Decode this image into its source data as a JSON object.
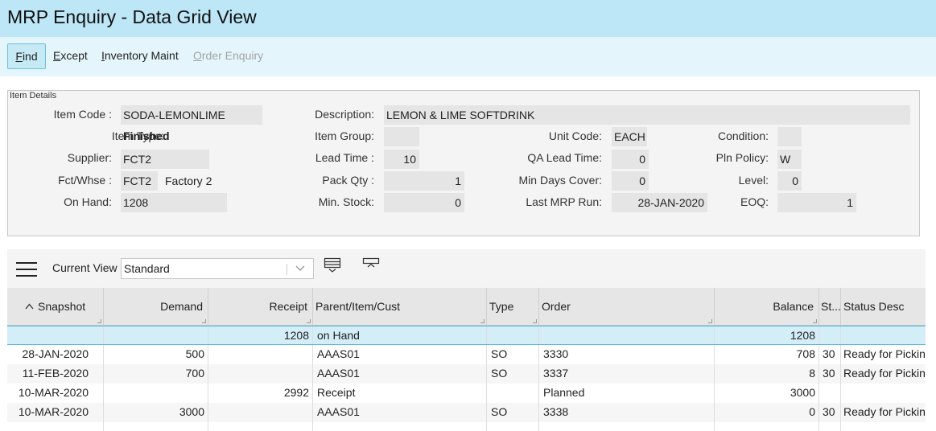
{
  "window": {
    "title": "MRP Enquiry - Data Grid View"
  },
  "toolbar": {
    "find": {
      "hot": "F",
      "rest": "ind"
    },
    "except": {
      "hot": "E",
      "rest": "xcept"
    },
    "inventory": {
      "hot": "I",
      "rest": "nventory Maint"
    },
    "order": {
      "hot": "O",
      "rest": "rder Enquiry"
    }
  },
  "details": {
    "legend": "Item Details",
    "labels": {
      "item_code": "Item Code :",
      "item_type": "Item Type:",
      "supplier": "Supplier:",
      "fct_whse": "Fct/Whse :",
      "on_hand": "On Hand:",
      "description": "Description:",
      "item_group": "Item Group:",
      "lead_time": "Lead Time :",
      "pack_qty": "Pack Qty :",
      "min_stock": "Min. Stock:",
      "unit_code": "Unit Code:",
      "qa_lead_time": "QA Lead Time:",
      "min_days_cover": "Min Days Cover:",
      "last_mrp_run": "Last MRP Run:",
      "condition": "Condition:",
      "pln_policy": "Pln Policy:",
      "level": "Level:",
      "eoq": "EOQ:"
    },
    "values": {
      "item_code": "SODA-LEMONLIME",
      "item_type": "Finished",
      "supplier": "FCT2",
      "fct": "FCT2",
      "factory_name": "Factory 2",
      "on_hand": "1208",
      "description": "LEMON & LIME SOFTDRINK",
      "item_group": "",
      "lead_time": "10",
      "pack_qty": "1",
      "min_stock": "0",
      "unit_code": "EACH",
      "qa_lead_time": "0",
      "min_days_cover": "0",
      "last_mrp_run": "28-JAN-2020",
      "condition": "",
      "pln_policy": "W",
      "level": "0",
      "eoq": "1"
    }
  },
  "gridbar": {
    "current_view_label": "Current View",
    "current_view_value": "Standard"
  },
  "grid": {
    "sort_indicator": "▲",
    "columns": {
      "snapshot": "Snapshot",
      "demand": "Demand",
      "receipt": "Receipt",
      "parent": "Parent/Item/Cust",
      "type": "Type",
      "order": "Order",
      "balance": "Balance",
      "status": "St...",
      "status_desc": "Status Desc"
    },
    "summary": {
      "receipt": "1208",
      "parent": "on Hand",
      "balance": "1208"
    },
    "rows": [
      {
        "snapshot": "28-JAN-2020",
        "demand": "500",
        "receipt": "",
        "parent": "AAAS01",
        "type": "SO",
        "order": "3330",
        "balance": "708",
        "status": "30",
        "status_desc": "Ready for Picking"
      },
      {
        "snapshot": "11-FEB-2020",
        "demand": "700",
        "receipt": "",
        "parent": "AAAS01",
        "type": "SO",
        "order": "3337",
        "balance": "8",
        "status": "30",
        "status_desc": "Ready for Picking"
      },
      {
        "snapshot": "10-MAR-2020",
        "demand": "",
        "receipt": "2992",
        "parent": "Receipt",
        "type": "",
        "order": "Planned",
        "balance": "3000",
        "status": "",
        "status_desc": ""
      },
      {
        "snapshot": "10-MAR-2020",
        "demand": "3000",
        "receipt": "",
        "parent": "AAAS01",
        "type": "SO",
        "order": "3338",
        "balance": "0",
        "status": "30",
        "status_desc": "Ready for Picking"
      }
    ]
  }
}
